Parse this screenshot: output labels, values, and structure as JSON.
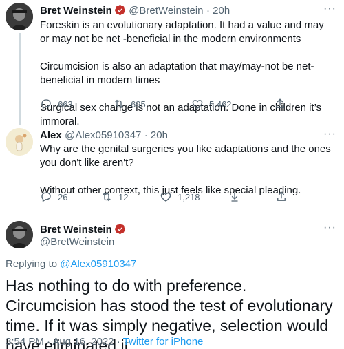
{
  "tweet1": {
    "name": "Bret Weinstein",
    "handle": "@BretWeinstein",
    "time": "· 20h",
    "paragraphs": [
      "Foreskin is an evolutionary adaptation. It had a value and may or may not be net -beneficial in the modern environments",
      "Circumcision is also an adaptation that may/may-not be net-beneficial in modern times",
      "Surgical sex change is not an adaptation. Done in children it’s immoral."
    ],
    "replies": "663",
    "retweets": "695",
    "likes": "5,462"
  },
  "tweet2": {
    "name": "Alex",
    "handle": "@Alex05910347",
    "time": "· 20h",
    "paragraphs": [
      "Why are the genital surgeries you like adaptations and the ones you don't like aren't?",
      "Without other context, this just feels like special pleading."
    ],
    "replies": "26",
    "retweets": "12",
    "likes": "1,218"
  },
  "main": {
    "name": "Bret Weinstein",
    "handle": "@BretWeinstein",
    "replying_prefix": "Replying to ",
    "replying_to": "@Alex05910347",
    "text": "Has nothing to do with preference. Circumcision has stood the test of evolutionary time. If it was simply negative, selection would have eliminated it.",
    "timestamp": "3:54 PM · Aug 16, 2022 · ",
    "source": "Twitter for iPhone"
  },
  "more_glyph": "···",
  "colors": {
    "link": "#1d9bf0",
    "secondary": "#536471",
    "verified": "#c4302b"
  }
}
